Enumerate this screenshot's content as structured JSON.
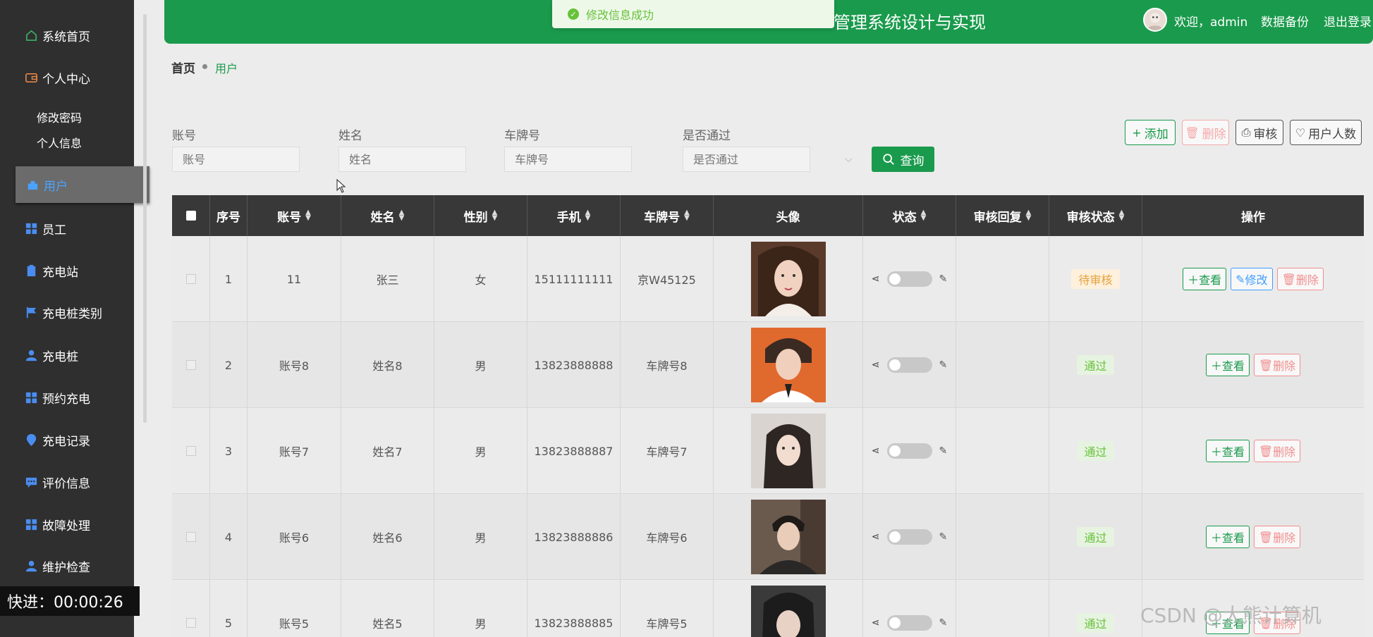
{
  "header": {
    "title": "管理系统设计与实现",
    "welcome": "欢迎，admin",
    "backup": "数据备份",
    "logout": "退出登录"
  },
  "toast": {
    "message": "修改信息成功"
  },
  "sidebar": {
    "items": [
      {
        "label": "系统首页",
        "icon": "home-icon"
      },
      {
        "label": "个人中心",
        "icon": "wallet-icon"
      },
      {
        "label": "修改密码"
      },
      {
        "label": "个人信息"
      },
      {
        "label": "用户",
        "icon": "user-icon"
      },
      {
        "label": "员工",
        "icon": "grid-icon"
      },
      {
        "label": "充电站",
        "icon": "clipboard-icon"
      },
      {
        "label": "充电桩类别",
        "icon": "flag-icon"
      },
      {
        "label": "充电桩",
        "icon": "person-icon"
      },
      {
        "label": "预约充电",
        "icon": "grid-icon"
      },
      {
        "label": "充电记录",
        "icon": "location-icon"
      },
      {
        "label": "评价信息",
        "icon": "chat-icon"
      },
      {
        "label": "故障处理",
        "icon": "grid-icon"
      },
      {
        "label": "维护检查",
        "icon": "person-icon"
      }
    ]
  },
  "breadcrumb": {
    "home": "首页",
    "current": "用户"
  },
  "search": {
    "account_label": "账号",
    "account_placeholder": "账号",
    "name_label": "姓名",
    "name_placeholder": "姓名",
    "plate_label": "车牌号",
    "plate_placeholder": "车牌号",
    "passed_label": "是否通过",
    "passed_placeholder": "是否通过",
    "query": "查询"
  },
  "toolbar": {
    "add": "添加",
    "delete": "删除",
    "audit": "审核",
    "count": "用户人数"
  },
  "table": {
    "headers": [
      "序号",
      "账号",
      "姓名",
      "性别",
      "手机",
      "车牌号",
      "头像",
      "状态",
      "审核回复",
      "审核状态",
      "操作"
    ],
    "rows": [
      {
        "no": "1",
        "account": "11",
        "name": "张三",
        "gender": "女",
        "phone": "15111111111",
        "plate": "京W45125",
        "reply": "",
        "audit": "待审核"
      },
      {
        "no": "2",
        "account": "账号8",
        "name": "姓名8",
        "gender": "男",
        "phone": "13823888888",
        "plate": "车牌号8",
        "reply": "",
        "audit": "通过"
      },
      {
        "no": "3",
        "account": "账号7",
        "name": "姓名7",
        "gender": "男",
        "phone": "13823888887",
        "plate": "车牌号7",
        "reply": "",
        "audit": "通过"
      },
      {
        "no": "4",
        "account": "账号6",
        "name": "姓名6",
        "gender": "男",
        "phone": "13823888886",
        "plate": "车牌号6",
        "reply": "",
        "audit": "通过"
      },
      {
        "no": "5",
        "account": "账号5",
        "name": "姓名5",
        "gender": "男",
        "phone": "13823888885",
        "plate": "车牌号5",
        "reply": "",
        "audit": "通过"
      }
    ],
    "actions": {
      "view": "查看",
      "edit": "修改",
      "delete": "删除"
    }
  },
  "overlay": {
    "progress": "快进：00:00:26",
    "watermark": "CSDN @大熊计算机"
  },
  "colors": {
    "brand": "#1a9a4c",
    "sidebar": "#2f2f2f",
    "blue": "#409eff",
    "pending": "#e6a23c",
    "pass": "#67c23a"
  }
}
